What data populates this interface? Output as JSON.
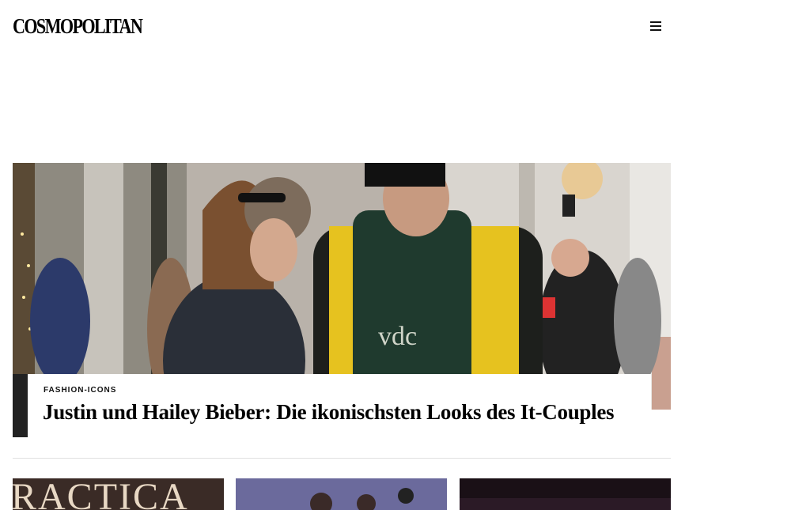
{
  "header": {
    "logo": "COSMOPOLITAN",
    "menu_icon": "hamburger-menu-icon"
  },
  "hero": {
    "kicker": "FASHION-ICONS",
    "headline": "Justin und Hailey Bieber: Die ikonischsten Looks des It-Couples"
  },
  "cards": [
    {
      "image_text": "RACTICA"
    },
    {
      "image_text": ""
    },
    {
      "image_text": ""
    }
  ]
}
